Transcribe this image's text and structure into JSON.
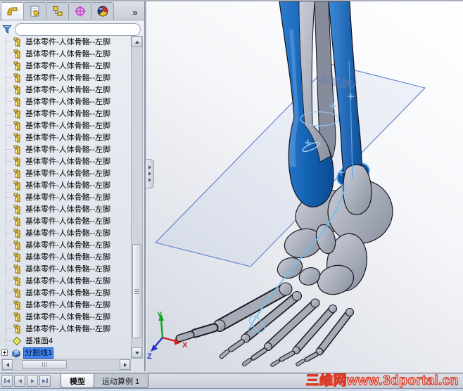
{
  "window": {
    "watermark": "三维网www.3dportal.cn"
  },
  "panel": {
    "tabs": [
      {
        "name": "featuremanager-tab",
        "icon": "featuremanager-tree-icon",
        "active": true
      },
      {
        "name": "propertymanager-tab",
        "icon": "propertymanager-icon",
        "active": false
      },
      {
        "name": "configurationmanager-tab",
        "icon": "configurationmanager-icon",
        "active": false
      },
      {
        "name": "dimxpertmanager-tab",
        "icon": "dimxpert-crosshair-icon",
        "active": false
      },
      {
        "name": "displaymanager-tab",
        "icon": "display-sphere-icon",
        "active": false
      }
    ],
    "overflow_label": "»",
    "filter": {
      "icon": "filter-funnel-icon",
      "value": "",
      "placeholder": ""
    },
    "tree": {
      "repeated_item_label": "基体零件-人体骨骼--左脚",
      "repeated_item_count": 25,
      "plane_item_label": "基准面4",
      "selected_item_label": "分割线1"
    }
  },
  "viewport": {
    "plane_label": "基准面4",
    "triad": {
      "x_label": "X",
      "y_label": "Y",
      "z_label": "Z"
    },
    "colors": {
      "selection_blue": "#1565b5",
      "bone_gray": "#a0a5b2",
      "plane_edge": "#5b7fc8",
      "split_line_blue": "#6cc0ee",
      "background_top": "#ffffff",
      "background_bottom": "#d3d7e0"
    }
  },
  "bottom_bar": {
    "tabs": [
      {
        "label": "模型",
        "active": true
      },
      {
        "label": "运动算例 1",
        "active": false
      }
    ]
  }
}
